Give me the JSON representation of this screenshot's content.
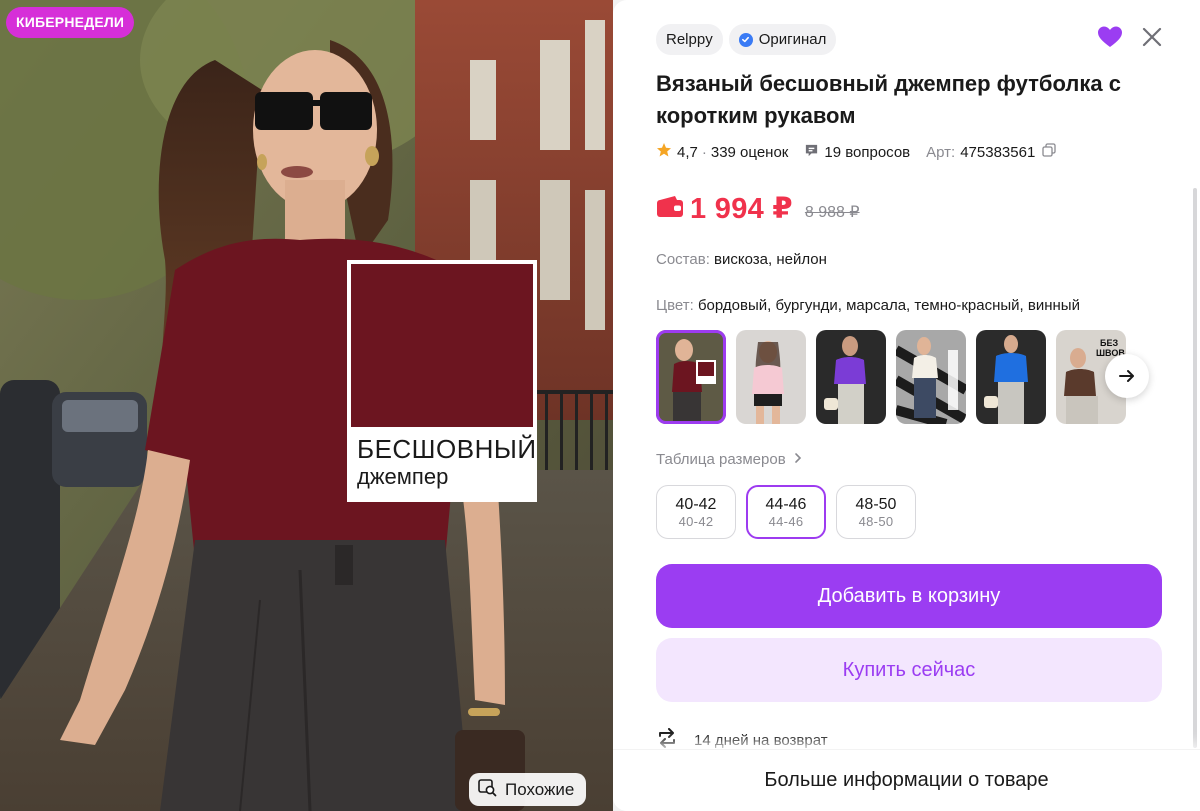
{
  "gallery": {
    "promo_badge": "КИБЕРНЕДЕЛИ",
    "label_line1": "БЕСШОВНЫЙ",
    "label_line2": "джемпер",
    "similar_label": "Похожие"
  },
  "product": {
    "brand": "Relppy",
    "original_badge": "Оригинал",
    "title": "Вязаный бесшовный джемпер футболка с коротким рукавом",
    "rating": "4,7",
    "reviews": "339 оценок",
    "questions": "19 вопросов",
    "article_label": "Арт:",
    "article": "475383561",
    "price": "1 994 ₽",
    "old_price": "8 988 ₽",
    "composition_label": "Состав:",
    "composition": "вискоза, нейлон",
    "color_label": "Цвет:",
    "color_value": "бордовый, бургунди, марсала, темно-красный, винный",
    "thumbnail_badge": "БЕЗ ШВОВ"
  },
  "sizes": {
    "table_link": "Таблица размеров",
    "options": [
      {
        "label": "40-42",
        "sub": "40-42",
        "selected": false
      },
      {
        "label": "44-46",
        "sub": "44-46",
        "selected": true
      },
      {
        "label": "48-50",
        "sub": "48-50",
        "selected": false
      }
    ]
  },
  "actions": {
    "add_to_cart": "Добавить в корзину",
    "buy_now": "Купить сейчас",
    "returns": "14 дней на возврат",
    "more_info": "Больше информации о товаре"
  },
  "icons": {
    "favorite": "heart-icon",
    "close": "close-icon",
    "rating": "star-icon",
    "questions": "chat-bubble-icon",
    "copy": "copy-icon",
    "wallet": "wallet-icon",
    "next": "arrow-right-icon",
    "returns": "return-arrows-icon",
    "similar": "image-search-icon"
  },
  "colors": {
    "accent": "#9B3DF2",
    "price": "#F0324C",
    "promo": "#D62FD8",
    "swatch": "#6C1520"
  }
}
